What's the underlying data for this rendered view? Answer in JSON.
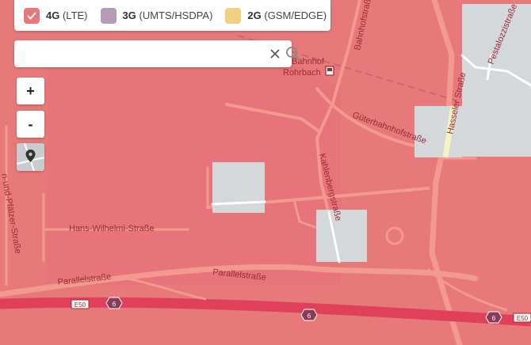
{
  "legend": {
    "items": [
      {
        "tech": "4G",
        "detail": "(LTE)",
        "color": "#e8797a",
        "checked": true
      },
      {
        "tech": "3G",
        "detail": "(UMTS/HSDPA)",
        "color": "#b79ab6",
        "checked": false
      },
      {
        "tech": "2G",
        "detail": "(GSM/EDGE)",
        "color": "#f2cf7e",
        "checked": false
      }
    ]
  },
  "search": {
    "value": "",
    "placeholder": ""
  },
  "controls": {
    "zoom_in": "+",
    "zoom_out": "-"
  },
  "map": {
    "streets": {
      "bahnhofstrasse": "Bahnhofstraße",
      "bahnhof": "Bahnhof",
      "rohrbach": "Rohrbach",
      "hasseler": "Hasseler Straße",
      "pestalozzi": "Pestalozzistraße",
      "gueterbahnhof": "Güterbahnhofstraße",
      "kahlenberg": "Kahlenbergstraße",
      "hans_wilhelmi": "Hans-Wilhelmi-Straße",
      "pfaelzer": "n-und-Pfälzer-Straße",
      "parallel_left": "Parallelstraße",
      "parallel_mid": "Parallelstraße"
    },
    "shields": {
      "e50_left": "E50",
      "e50_right": "E50",
      "route_a": "6",
      "route_b": "6",
      "route_c": "6"
    }
  },
  "colors": {
    "coverage_4g": "#e8797a",
    "road": "#f29a8f",
    "motorway": "#e0415a",
    "no_coverage": "#d4d8db"
  }
}
